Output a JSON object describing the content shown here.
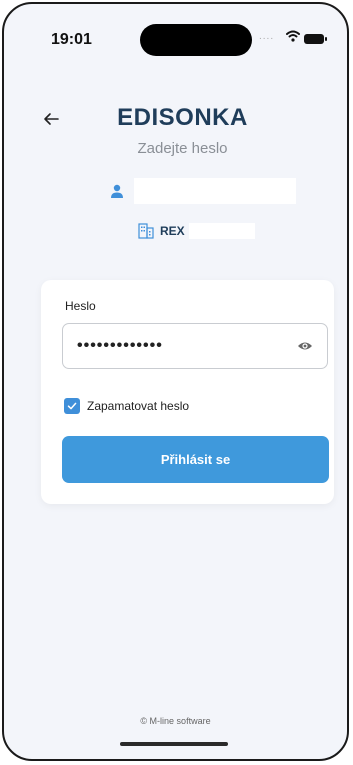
{
  "status_bar": {
    "time": "19:01",
    "signal": "....",
    "icons": [
      "wifi-icon",
      "battery-icon"
    ]
  },
  "header": {
    "back_icon": "back-arrow-icon",
    "title": "EDISONKA",
    "subtitle": "Zadejte heslo"
  },
  "account": {
    "user_icon": "user-icon",
    "company_icon": "building-icon",
    "company_name": "REX"
  },
  "login_card": {
    "password_label": "Heslo",
    "password_value": "•••••••••••••",
    "remember_label": "Zapamatovat heslo",
    "remember_checked": true,
    "submit_label": "Přihlásit se"
  },
  "footer": {
    "copyright": "© M-line software"
  },
  "colors": {
    "background": "#f3f5fa",
    "title": "#1f3d5a",
    "accent": "#3f99dc",
    "checkbox": "#3f8fd9"
  }
}
